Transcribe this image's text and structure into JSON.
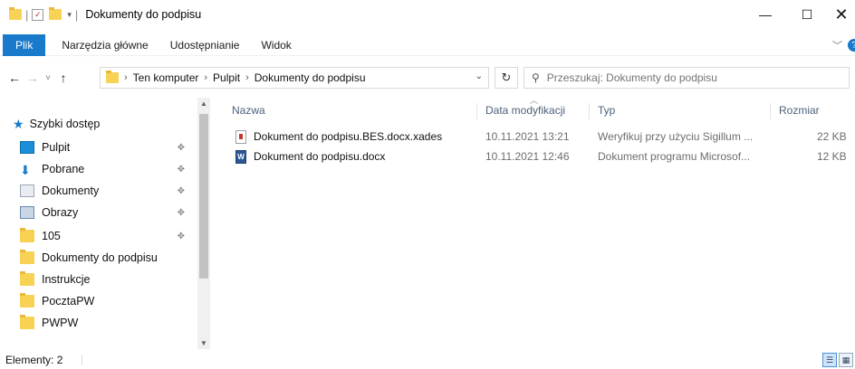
{
  "window": {
    "title": "Dokumenty do podpisu",
    "controls": {
      "minimize": "—",
      "maximize": "☐",
      "close": "✕"
    }
  },
  "ribbon": {
    "tabs": [
      "Plik",
      "Narzędzia główne",
      "Udostępnianie",
      "Widok"
    ],
    "help_glyph": "?",
    "accent": "#1979ca"
  },
  "address": {
    "breadcrumbs": [
      "Ten komputer",
      "Pulpit",
      "Dokumenty do podpisu"
    ],
    "search_placeholder": "Przeszukaj: Dokumenty do podpisu"
  },
  "nav": {
    "quick_access": "Szybki dostęp",
    "items": [
      {
        "label": "Pulpit",
        "icon": "desktop-icon",
        "pinned": true
      },
      {
        "label": "Pobrane",
        "icon": "download-icon",
        "pinned": true
      },
      {
        "label": "Dokumenty",
        "icon": "documents-icon",
        "pinned": true
      },
      {
        "label": "Obrazy",
        "icon": "pictures-icon",
        "pinned": true
      },
      {
        "label": "105",
        "icon": "folder-icon",
        "pinned": true
      },
      {
        "label": "Dokumenty do podpisu",
        "icon": "folder-icon",
        "pinned": false
      },
      {
        "label": "Instrukcje",
        "icon": "folder-icon",
        "pinned": false
      },
      {
        "label": "PocztaPW",
        "icon": "folder-icon",
        "pinned": false
      },
      {
        "label": "PWPW",
        "icon": "folder-icon",
        "pinned": false
      }
    ]
  },
  "columns": {
    "name": "Nazwa",
    "modified": "Data modyfikacji",
    "type": "Typ",
    "size": "Rozmiar"
  },
  "files": [
    {
      "name": "Dokument do podpisu.BES.docx.xades",
      "modified": "10.11.2021 13:21",
      "type": "Weryfikuj przy użyciu Sigillum ...",
      "size": "22 KB",
      "icon": "xades-file-icon"
    },
    {
      "name": "Dokument do podpisu.docx",
      "modified": "10.11.2021 12:46",
      "type": "Dokument programu Microsof...",
      "size": "12 KB",
      "icon": "word-file-icon"
    }
  ],
  "status": {
    "items_count": "Elementy: 2"
  }
}
